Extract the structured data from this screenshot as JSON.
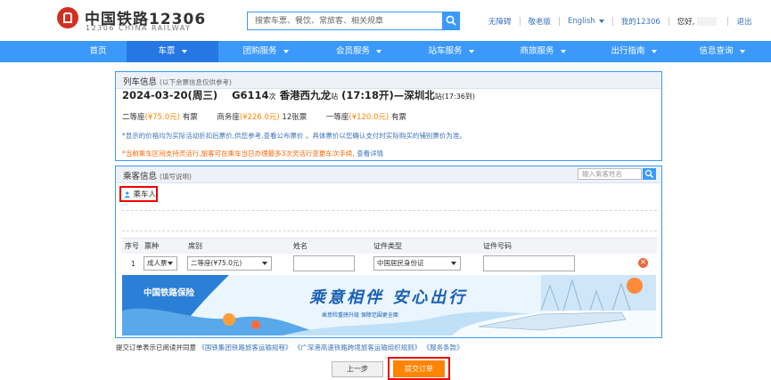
{
  "header": {
    "logo_cn": "中国铁路12306",
    "logo_en": "12306 CHINA RAILWAY",
    "search_placeholder": "搜索车票、餐饮、常旅客、相关规章",
    "links": [
      "无障碍",
      "敬老版",
      "English",
      "我的12306"
    ],
    "greeting": "您好,",
    "logout": "退出"
  },
  "nav": {
    "items": [
      "首页",
      "车票",
      "团购服务",
      "会员服务",
      "站车服务",
      "商旅服务",
      "出行指南",
      "信息查询"
    ]
  },
  "train_info": {
    "title": "列车信息",
    "title_note": "(以下余票信息仅供参考)",
    "date": "2024-03-20(周三)",
    "train_no": "G6114",
    "train_suffix": "次",
    "from_station": "香港西九龙",
    "from_suffix": "站",
    "depart": "(17:18开)",
    "dash": "—",
    "to_station": "深圳北",
    "to_suffix": "站",
    "arrive": "(17:36到)",
    "seats": [
      {
        "name": "二等座",
        "price": "(¥75.0元)",
        "status": "有票"
      },
      {
        "name": "商务座",
        "price": "(¥226.0元)",
        "status": "12张票"
      },
      {
        "name": "一等座",
        "price": "(¥120.0元)",
        "status": "有票"
      }
    ],
    "note_price": "*显示的价格均为实际活动折扣后票价,供您参考,查看公布票价 。具体票价以您确认支付时实际购买的铺别票价为准。",
    "note_change": "*当前乘车区间支持灵活行,旅客可在乘车当日办理最多3次灵活行变更车次手续,",
    "note_change_link": "查看详情"
  },
  "passenger": {
    "title": "乘客信息",
    "title_note": "(填写说明)",
    "search_placeholder": "输入乘客姓名",
    "chip_label": "乘车人",
    "table_headers": [
      "序号",
      "票种",
      "席别",
      "姓名",
      "证件类型",
      "证件号码"
    ],
    "row": {
      "index": "1",
      "ticket_type": "成人票",
      "seat": "二等座(¥75.0元)",
      "id_type": "中国居民身份证"
    },
    "del_symbol": "×"
  },
  "banner": {
    "logo": "中国铁路保险",
    "slogan": "乘意相伴 安心出行",
    "sub": "乘意险重磅升级 保障范围更全面"
  },
  "footer": {
    "agree_prefix": "提交订单表示已阅读并同意",
    "agree_links": [
      "《国铁集团铁路旅客运输规程》",
      "《广深港高速铁路跨境旅客运输组织规则》",
      "《服务条款》"
    ],
    "prev_btn": "上一步",
    "submit_btn": "提交订单"
  },
  "colors": {
    "primary": "#3b99fc",
    "nav_active": "#2676e3",
    "accent": "#ff8400",
    "highlight_box": "#e00000"
  }
}
